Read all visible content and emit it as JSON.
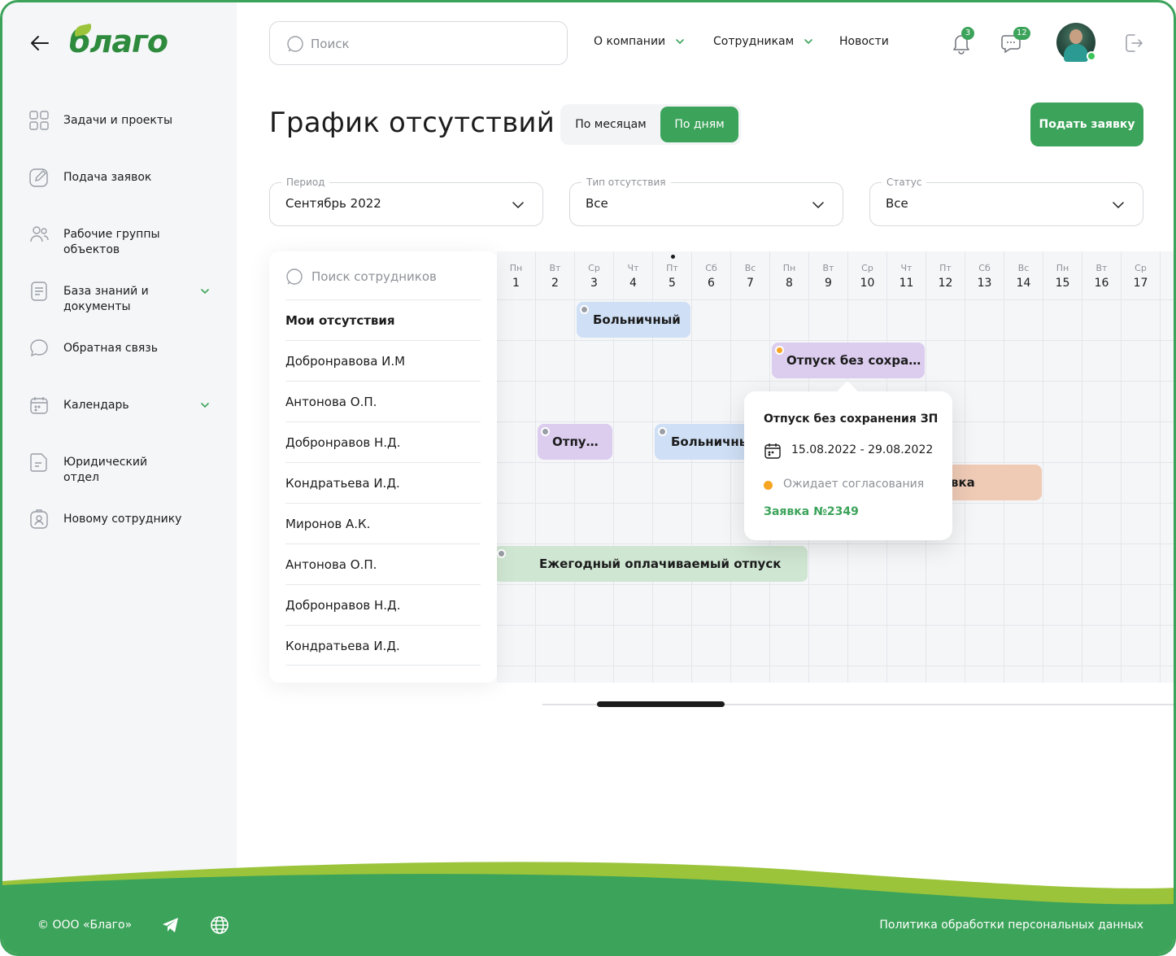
{
  "brand": {
    "logo_text": "благо"
  },
  "sidebar": {
    "items": [
      {
        "label": "Задачи и проекты",
        "icon": "grid-icon"
      },
      {
        "label": "Подача заявок",
        "icon": "edit-icon"
      },
      {
        "label": "Рабочие группы объектов",
        "icon": "users-icon"
      },
      {
        "label": "База знаний и документы",
        "icon": "book-icon"
      },
      {
        "label": "Обратная связь",
        "icon": "chat-icon"
      },
      {
        "label": "Календарь",
        "icon": "calendar-icon"
      },
      {
        "label": "Юридический отдел",
        "icon": "document-icon"
      },
      {
        "label": "Новому сотруднику",
        "icon": "badge-icon"
      }
    ]
  },
  "header": {
    "search_placeholder": "Поиск",
    "nav": [
      "О компании",
      "Сотрудникам",
      "Новости"
    ],
    "notifications_count": "3",
    "messages_count": "12"
  },
  "page": {
    "title": "График отсутствий",
    "view_month": "По месяцам",
    "view_day": "По дням",
    "submit": "Подать заявку"
  },
  "filters": {
    "period": {
      "label": "Период",
      "value": "Сентябрь 2022"
    },
    "type": {
      "label": "Тип отсутствия",
      "value": "Все"
    },
    "status": {
      "label": "Статус",
      "value": "Все"
    }
  },
  "employees": {
    "search_placeholder": "Поиск сотрудников",
    "rows": [
      "Мои отсутствия",
      "Добронравова И.М",
      "Антонова О.П.",
      "Добронравов Н.Д.",
      "Кондратьева И.Д.",
      "Миронов А.К.",
      "Антонова О.П.",
      "Добронравов Н.Д.",
      "Кондратьева И.Д."
    ]
  },
  "calendar": {
    "days": [
      {
        "w": "Пн",
        "n": "1"
      },
      {
        "w": "Вт",
        "n": "2"
      },
      {
        "w": "Ср",
        "n": "3"
      },
      {
        "w": "Чт",
        "n": "4"
      },
      {
        "w": "Пт",
        "n": "5"
      },
      {
        "w": "Сб",
        "n": "6"
      },
      {
        "w": "Вс",
        "n": "7"
      },
      {
        "w": "Пн",
        "n": "8"
      },
      {
        "w": "Вт",
        "n": "9"
      },
      {
        "w": "Ср",
        "n": "10"
      },
      {
        "w": "Чт",
        "n": "11"
      },
      {
        "w": "Пт",
        "n": "12"
      },
      {
        "w": "Сб",
        "n": "13"
      },
      {
        "w": "Вс",
        "n": "14"
      },
      {
        "w": "Пн",
        "n": "15"
      },
      {
        "w": "Вт",
        "n": "16"
      },
      {
        "w": "Ср",
        "n": "17"
      }
    ],
    "bars": {
      "b1": "Больничный",
      "b2": "Отпуск без сохра…",
      "b3": "Отпу…",
      "b4": "Больничный",
      "b5": "вка",
      "b6": "Ежегодный оплачиваемый отпуск"
    }
  },
  "tooltip": {
    "title": "Отпуск без сохранения ЗП",
    "dates": "15.08.2022 - 29.08.2022",
    "status": "Ожидает согласования",
    "link": "Заявка №2349"
  },
  "footer": {
    "copyright": "© ООО «Благо»",
    "policy": "Политика обработки персональных данных"
  },
  "colors": {
    "accent": "#3ca35a",
    "pending": "#f6a523"
  }
}
